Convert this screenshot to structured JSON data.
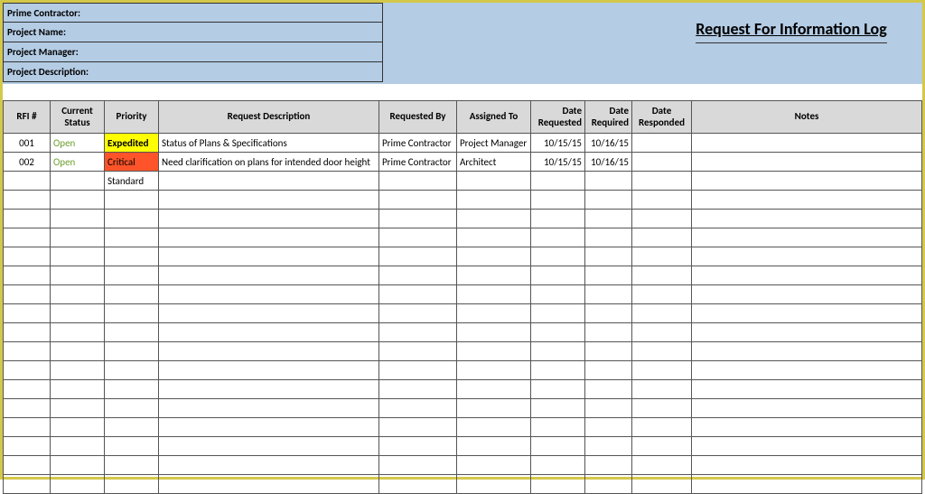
{
  "header": {
    "meta": [
      "Prime Contractor:",
      "Project Name:",
      "Project Manager:",
      "Project Description:"
    ],
    "title": "Request For Information Log"
  },
  "table": {
    "columns": [
      "RFI #",
      "Current Status",
      "Priority",
      "Request Description",
      "Requested By",
      "Assigned To",
      "Date Requested",
      "Date Required",
      "Date Responded",
      "Notes"
    ],
    "rows": [
      {
        "rfi": "001",
        "status": "Open",
        "priority": "Expedited",
        "priority_class": "priority-expedited",
        "desc": "Status of Plans & Specifications",
        "reqby": "Prime Contractor",
        "assigned": "Project Manager",
        "datereq": "10/15/15",
        "datereq2": "10/16/15",
        "dateresp": "",
        "notes": ""
      },
      {
        "rfi": "002",
        "status": "Open",
        "priority": "Critical",
        "priority_class": "priority-critical",
        "desc": "Need clarification on plans for intended door height",
        "reqby": "Prime Contractor",
        "assigned": "Architect",
        "datereq": "10/15/15",
        "datereq2": "10/16/15",
        "dateresp": "",
        "notes": ""
      },
      {
        "rfi": "",
        "status": "",
        "priority": "Standard",
        "priority_class": "",
        "desc": "",
        "reqby": "",
        "assigned": "",
        "datereq": "",
        "datereq2": "",
        "dateresp": "",
        "notes": ""
      }
    ],
    "empty_rows": 16
  }
}
